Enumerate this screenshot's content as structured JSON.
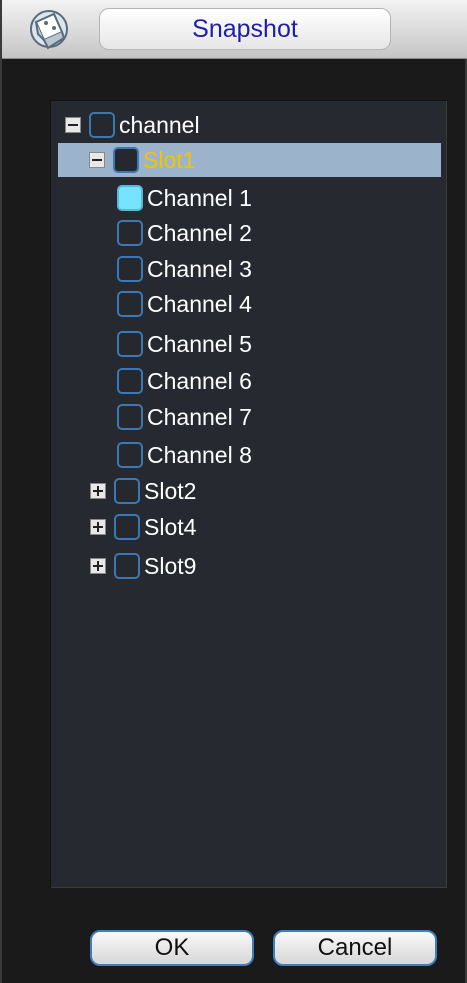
{
  "window": {
    "title": "Snapshot"
  },
  "tree": {
    "root": {
      "label": "channel",
      "expanded": true,
      "checked": false
    },
    "slots": [
      {
        "label": "Slot1",
        "expanded": true,
        "selected": true,
        "checked": false,
        "channels": [
          {
            "label": "Channel 1",
            "checked": true
          },
          {
            "label": "Channel 2",
            "checked": false
          },
          {
            "label": "Channel 3",
            "checked": false
          },
          {
            "label": "Channel 4",
            "checked": false
          },
          {
            "label": "Channel 5",
            "checked": false
          },
          {
            "label": "Channel 6",
            "checked": false
          },
          {
            "label": "Channel 7",
            "checked": false
          },
          {
            "label": "Channel 8",
            "checked": false
          }
        ]
      },
      {
        "label": "Slot2",
        "expanded": false,
        "checked": false
      },
      {
        "label": "Slot4",
        "expanded": false,
        "checked": false
      },
      {
        "label": "Slot9",
        "expanded": false,
        "checked": false
      }
    ]
  },
  "buttons": {
    "ok": "OK",
    "cancel": "Cancel"
  },
  "colors": {
    "title_text": "#1e1ea8",
    "selected_row_bg": "#9bb4cc",
    "selected_row_text": "#f2c400",
    "checkbox_border": "#3a78b6",
    "checkbox_checked": "#76e4ff",
    "panel_bg": "#262a30"
  }
}
